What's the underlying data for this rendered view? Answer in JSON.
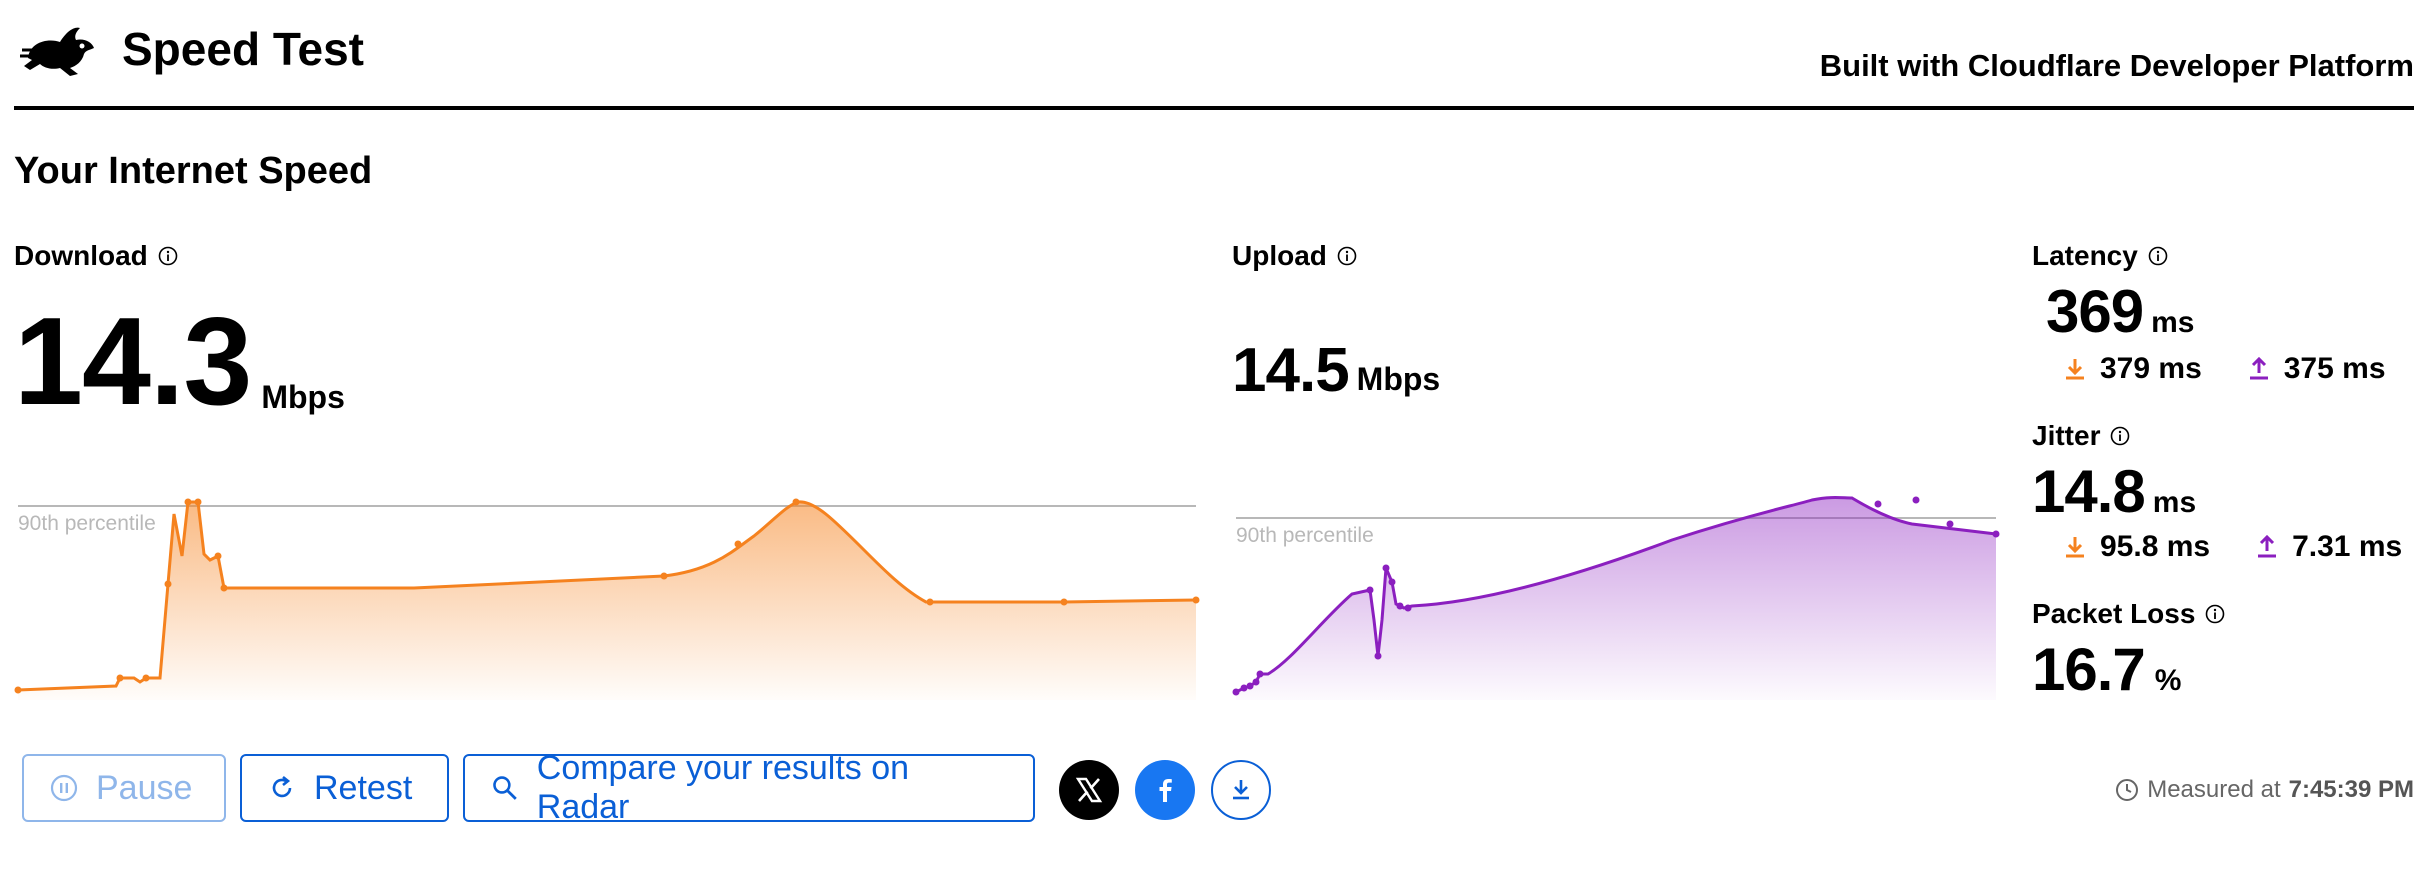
{
  "header": {
    "title": "Speed Test",
    "built_with": "Built with Cloudflare Developer Platform"
  },
  "section_title": "Your Internet Speed",
  "download": {
    "label": "Download",
    "value": "14.3",
    "unit": "Mbps",
    "percentile_label": "90th percentile",
    "color": "#f5821f"
  },
  "upload": {
    "label": "Upload",
    "value": "14.5",
    "unit": "Mbps",
    "percentile_label": "90th percentile",
    "color": "#8b1fbf"
  },
  "latency": {
    "label": "Latency",
    "value": "369",
    "unit": "ms",
    "down": "379 ms",
    "up": "375 ms"
  },
  "jitter": {
    "label": "Jitter",
    "value": "14.8",
    "unit": "ms",
    "down": "95.8 ms",
    "up": "7.31 ms"
  },
  "packet_loss": {
    "label": "Packet Loss",
    "value": "16.7",
    "unit": "%"
  },
  "actions": {
    "pause": "Pause",
    "retest": "Retest",
    "compare": "Compare your results on Radar"
  },
  "measured": {
    "prefix": "Measured at",
    "time": "7:45:39 PM"
  }
}
